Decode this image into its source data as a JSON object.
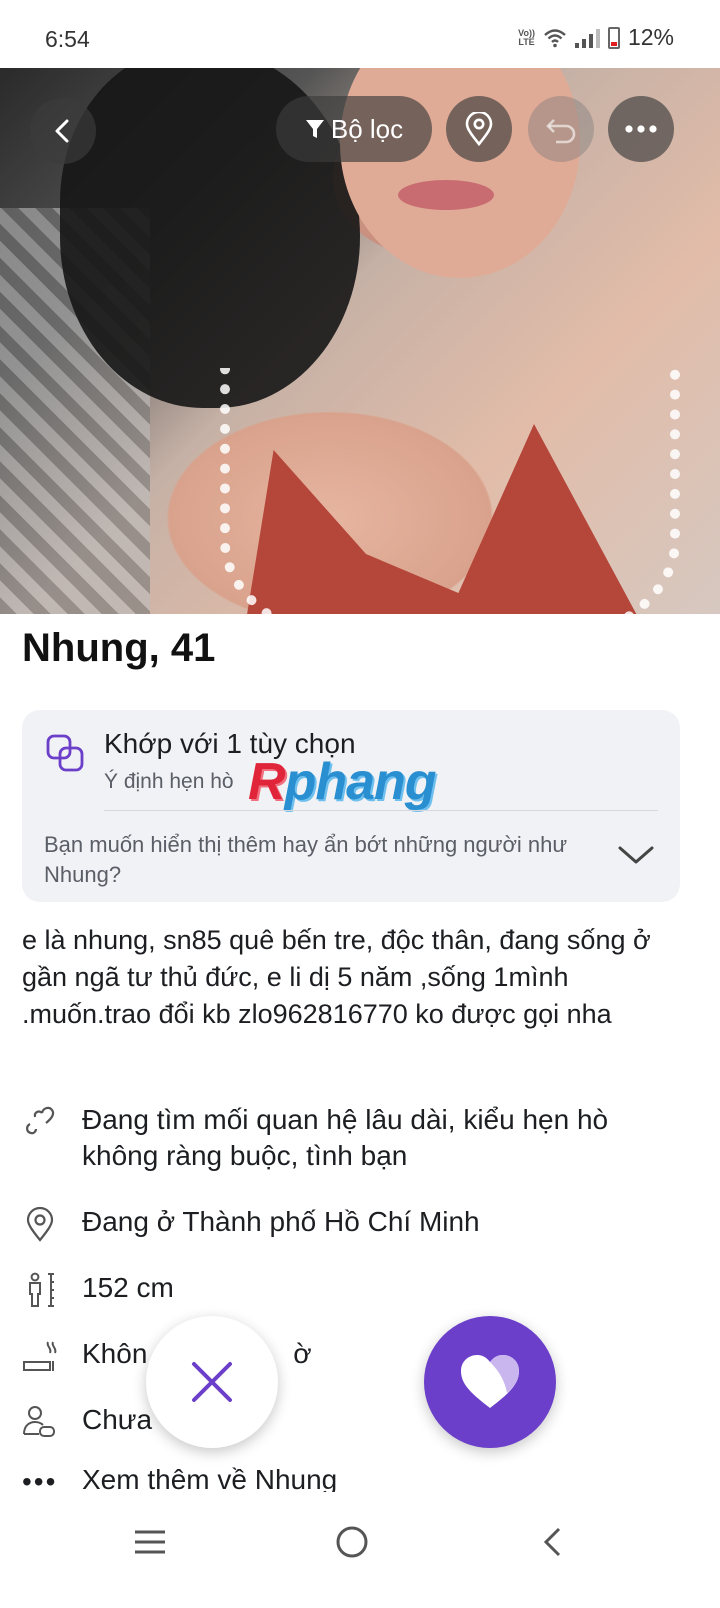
{
  "status_bar": {
    "time": "6:54",
    "volte_line1": "Vo))",
    "volte_line2": "LTE",
    "battery": "12%"
  },
  "top_controls": {
    "filter_label": "Bộ lọc"
  },
  "profile": {
    "name_age": "Nhung, 41"
  },
  "match": {
    "title": "Khớp với 1 tùy chọn",
    "subtitle": "Ý định hẹn hò",
    "watermark_first": "R",
    "watermark_rest": "phang",
    "question": "Bạn muốn hiển thị thêm hay ẩn bớt những người như Nhung?"
  },
  "bio": "e là nhung, sn85 quê bến tre,  độc thân, đang sống ở gần ngã tư thủ đức,  e li dị 5 năm ,sống 1mình  .muốn.trao đổi kb zlo962816770 ko được gọi nha",
  "details": {
    "looking_for": "Đang tìm mối quan hệ lâu dài, kiểu hẹn hò không ràng buộc, tình bạn",
    "location": "Đang ở Thành phố Hồ Chí Minh",
    "height": "152 cm",
    "smoking_partial_left": "Khôn",
    "smoking_partial_right": "ờ",
    "children_partial": "Chưa",
    "see_more": "Xem thêm về Nhung"
  },
  "icons": {
    "back": "chevron-left-icon",
    "filter": "funnel-icon",
    "location": "map-pin-icon",
    "undo": "undo-icon",
    "more": "more-horizontal-icon",
    "match": "overlap-squares-icon",
    "heart": "heart-icon",
    "pass": "close-icon"
  },
  "colors": {
    "accent": "#6b3fc9",
    "card_bg": "#f1f2f5"
  }
}
